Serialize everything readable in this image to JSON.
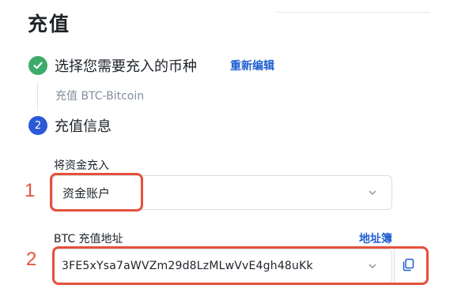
{
  "page": {
    "title": "充值"
  },
  "step1": {
    "title": "选择您需要充入的币种",
    "edit_label": "重新编辑",
    "summary": "充值 BTC-Bitcoin",
    "icon": "check-icon"
  },
  "step2": {
    "number": "2",
    "title": "充值信息"
  },
  "deposit_into": {
    "label": "将资金充入",
    "value": "资金账户"
  },
  "address": {
    "label": "BTC 充值地址",
    "book_label": "地址簿",
    "value": "3FE5xYsa7aWVZm29d8LzMLwVvE4gh48uKk"
  },
  "annotations": {
    "marker1": "1",
    "marker2": "2"
  },
  "colors": {
    "success": "#3dab6a",
    "accent": "#2a59d8",
    "link": "#1f5fd1",
    "highlight": "#e4513c"
  }
}
